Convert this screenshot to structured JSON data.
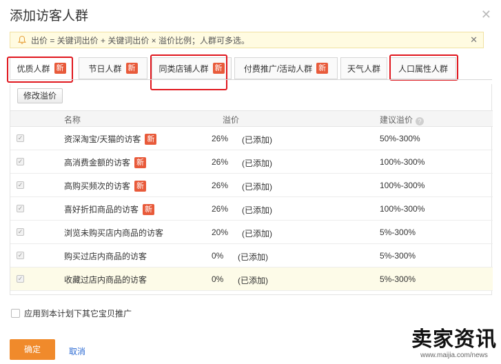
{
  "dialog": {
    "title": "添加访客人群",
    "notice": "出价 = 关键词出价 + 关键词出价 × 溢价比例；人群可多选。"
  },
  "tabs": [
    {
      "label": "优质人群",
      "badge": "新"
    },
    {
      "label": "节日人群",
      "badge": "新"
    },
    {
      "label": "同类店铺人群",
      "badge": "新"
    },
    {
      "label": "付费推广/活动人群",
      "badge": "新"
    },
    {
      "label": "天气人群",
      "badge": ""
    },
    {
      "label": "人口属性人群",
      "badge": ""
    }
  ],
  "toolbar": {
    "edit_label": "修改溢价"
  },
  "table": {
    "headers": {
      "name": "名称",
      "premium": "溢价",
      "suggest": "建议溢价"
    },
    "rows": [
      {
        "name": "资深淘宝/天猫的访客",
        "badge": "新",
        "pct": "26%",
        "added": "(已添加)",
        "suggest": "50%-300%"
      },
      {
        "name": "高消费金额的访客",
        "badge": "新",
        "pct": "26%",
        "added": "(已添加)",
        "suggest": "100%-300%"
      },
      {
        "name": "高购买频次的访客",
        "badge": "新",
        "pct": "26%",
        "added": "(已添加)",
        "suggest": "100%-300%"
      },
      {
        "name": "喜好折扣商品的访客",
        "badge": "新",
        "pct": "26%",
        "added": "(已添加)",
        "suggest": "100%-300%"
      },
      {
        "name": "浏览未购买店内商品的访客",
        "badge": "",
        "pct": "20%",
        "added": "(已添加)",
        "suggest": "5%-300%"
      },
      {
        "name": "购买过店内商品的访客",
        "badge": "",
        "pct": "0%",
        "added": "(已添加)",
        "suggest": "5%-300%"
      },
      {
        "name": "收藏过店内商品的访客",
        "badge": "",
        "pct": "0%",
        "added": "(已添加)",
        "suggest": "5%-300%"
      }
    ]
  },
  "apply_label": "应用到本计划下其它宝贝推广",
  "footer": {
    "ok_label": "确定",
    "cancel_label": "取消"
  },
  "watermark": {
    "text": "卖家资讯",
    "url": "www.maijia.com/news"
  },
  "colors": {
    "highlight": "#e0151c",
    "badge": "#e85a3a",
    "primary": "#f08a2b",
    "link": "#2d6bd3"
  }
}
